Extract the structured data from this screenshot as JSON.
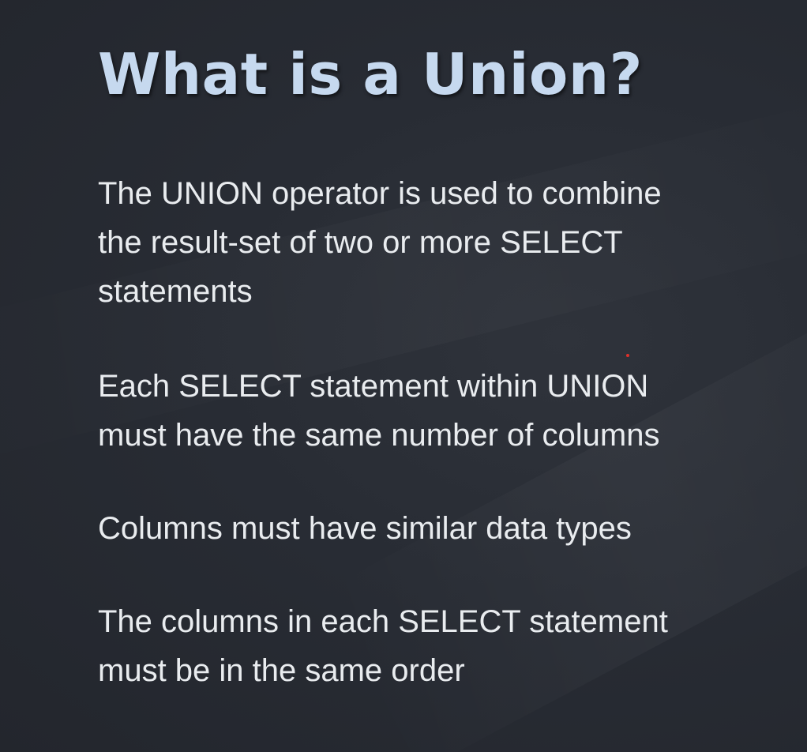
{
  "slide": {
    "title": "What is a Union?",
    "bullets": [
      {
        "lines": [
          "The UNION operator is used to combine",
          "the result-set of two or more SELECT",
          "statements"
        ]
      },
      {
        "lines": [
          "Each SELECT statement within UNION",
          "must have the same number of columns"
        ]
      },
      {
        "lines": [
          "Columns must have similar data types"
        ]
      },
      {
        "lines": [
          "The columns in each SELECT statement",
          "must be in the same order"
        ]
      }
    ]
  },
  "colors": {
    "background": "#282c34",
    "title": "#c6d9ef",
    "body_text": "#e9ecef",
    "pointer": "#e0302a"
  }
}
